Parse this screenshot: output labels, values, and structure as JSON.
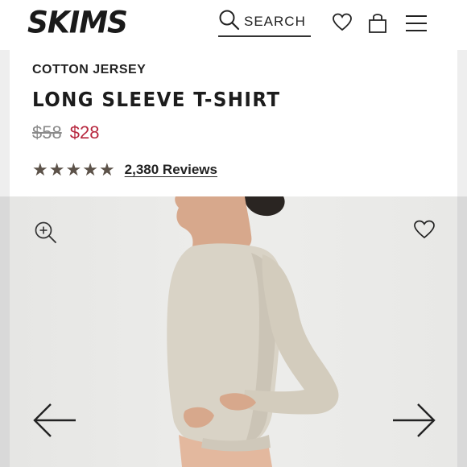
{
  "header": {
    "logo": "SKIMS",
    "search_label": "SEARCH",
    "icons": [
      "search-icon",
      "heart-icon",
      "shopping-bag-icon",
      "menu-icon"
    ]
  },
  "product": {
    "category": "COTTON JERSEY",
    "title": "LONG SLEEVE T-SHIRT",
    "price_original": "$58",
    "price_sale": "$28",
    "rating": 5,
    "reviews_label": "2,380 Reviews"
  },
  "gallery": {
    "icons": [
      "zoom-in-icon",
      "heart-icon",
      "arrow-left-icon",
      "arrow-right-icon"
    ]
  },
  "colors": {
    "sale_price": "#b7283f",
    "star": "#5c5249",
    "shirt": "#d9d3c6"
  }
}
